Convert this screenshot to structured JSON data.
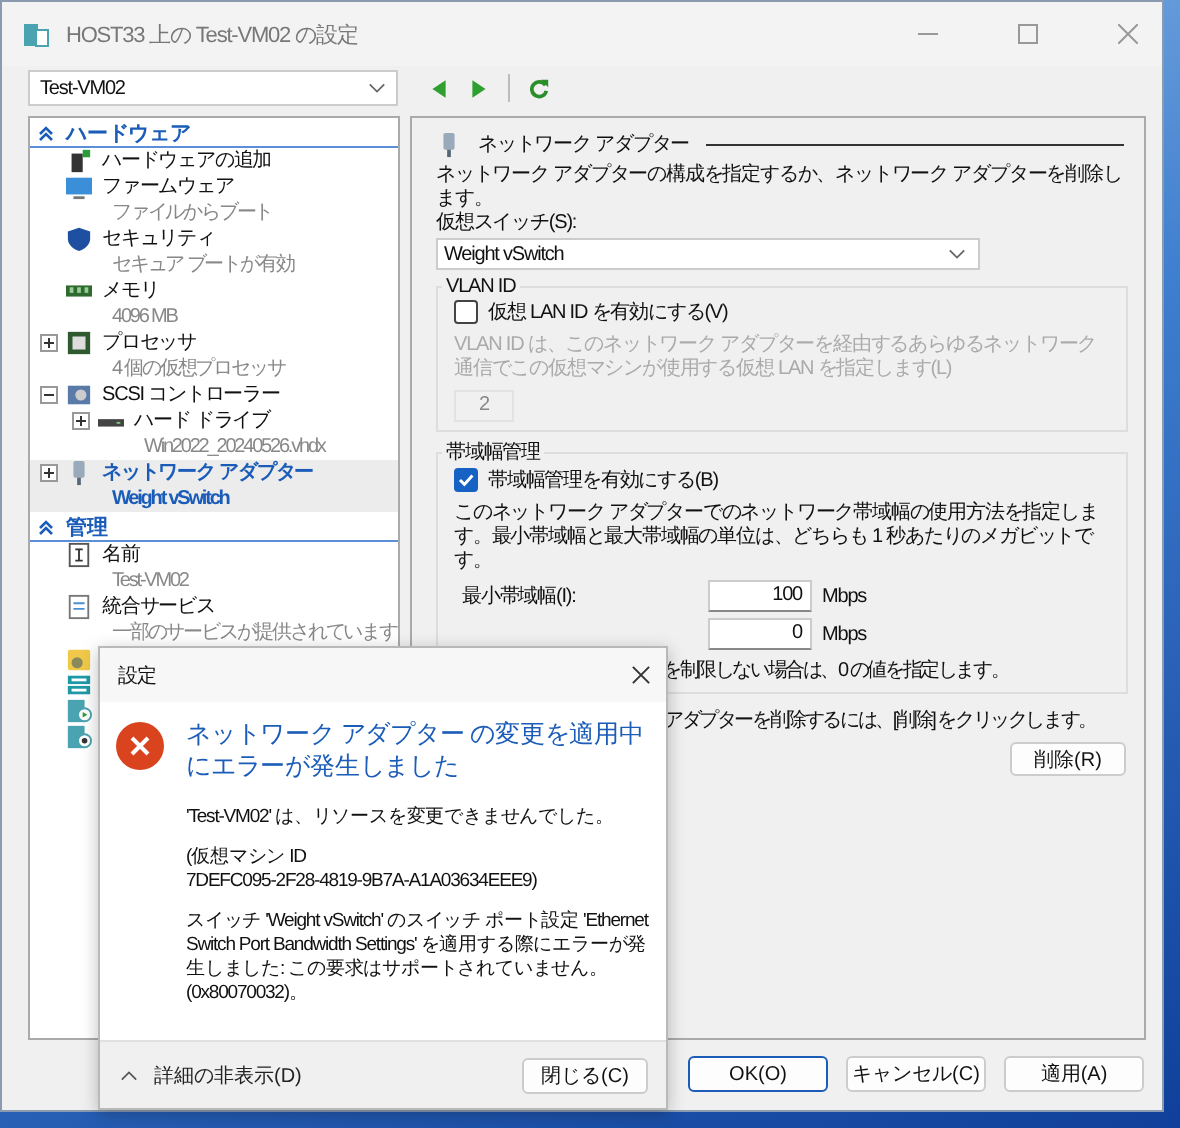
{
  "window": {
    "title": "HOST33 上の Test-VM02 の設定"
  },
  "vm_selector": {
    "value": "Test-VM02"
  },
  "sidebar": {
    "sections": [
      {
        "label": "ハードウェア",
        "expanded": true,
        "items": [
          {
            "kind": "add-hardware",
            "label": "ハードウェアの追加",
            "selected": false
          },
          {
            "kind": "firmware",
            "label": "ファームウェア",
            "detail": "ファイルからブート",
            "selected": false
          },
          {
            "kind": "security",
            "label": "セキュリティ",
            "detail": "セキュア ブートが有効",
            "selected": false
          },
          {
            "kind": "memory",
            "label": "メモリ",
            "detail": "4096 MB",
            "selected": false
          },
          {
            "kind": "processor",
            "label": "プロセッサ",
            "detail": "4 個の仮想プロセッサ",
            "expanded": false,
            "selected": false
          },
          {
            "kind": "scsi",
            "label": "SCSI コントローラー",
            "expanded": true,
            "selected": false,
            "children": [
              {
                "kind": "disk",
                "label": "ハード ドライブ",
                "detail": "Win2022_20240526.vhdx",
                "expanded": false,
                "selected": false
              }
            ]
          },
          {
            "kind": "network",
            "label": "ネットワーク アダプター",
            "detail": "Weight vSwitch",
            "expanded": false,
            "selected": true
          }
        ]
      },
      {
        "label": "管理",
        "expanded": true,
        "items": [
          {
            "kind": "name",
            "label": "名前",
            "detail": "Test-VM02",
            "selected": false
          },
          {
            "kind": "integration",
            "label": "統合サービス",
            "detail": "一部のサービスが提供されています",
            "selected": false
          },
          {
            "kind": "checkpoint",
            "selected": false
          },
          {
            "kind": "paging",
            "selected": false
          },
          {
            "kind": "autostart",
            "selected": false
          },
          {
            "kind": "autostop",
            "selected": false
          }
        ]
      }
    ]
  },
  "panel": {
    "title": "ネットワーク アダプター",
    "description": "ネットワーク アダプターの構成を指定するか、ネットワーク アダプターを削除します。",
    "switch_label": "仮想スイッチ(S):",
    "switch_value": "Weight vSwitch",
    "vlan": {
      "title": "VLAN ID",
      "checkbox": "仮想 LAN ID を有効にする(V)",
      "checked": false,
      "note": "VLAN ID は、このネットワーク アダプターを経由するあらゆるネットワーク通信でこの仮想マシンが使用する仮想 LAN を指定します(L)",
      "value": "2"
    },
    "bandwidth": {
      "title": "帯域幅管理",
      "checkbox": "帯域幅管理を有効にする(B)",
      "checked": true,
      "note": "このネットワーク アダプターでのネットワーク帯域幅の使用方法を指定します。最小帯域幅と最大帯域幅の単位は、どちらも 1 秒あたりのメガビットです。",
      "min_label": "最小帯域幅(I):",
      "min_value": "100",
      "min_unit": "Mbps",
      "max_value": "0",
      "max_unit": "Mbps",
      "hint": "を制限しない場合は、0 の値を指定します。"
    },
    "remove_note": "アダプターを削除するには、[削除] をクリックします。",
    "remove_button": "削除(R)"
  },
  "buttons": [
    "OK(O)",
    "キャンセル(C)",
    "適用(A)"
  ],
  "dialog": {
    "title": "設定",
    "heading": "ネットワーク アダプター の変更を適用中にエラーが発生しました",
    "paragraphs": [
      "'Test-VM02' は、リソースを変更できませんでした。",
      "(仮想マシン ID\n7DEFC095-2F28-4819-9B7A-A1A03634EEE9)",
      "スイッチ 'Weight vSwitch' のスイッチ ポート設定 'Ethernet Switch Port Bandwidth Settings' を適用する際にエラーが発生しました: この要求はサポートされていません。(0x80070032)。"
    ],
    "details_toggle": "詳細の非表示(D)",
    "details_expanded": true,
    "close_button": "閉じる(C)"
  }
}
